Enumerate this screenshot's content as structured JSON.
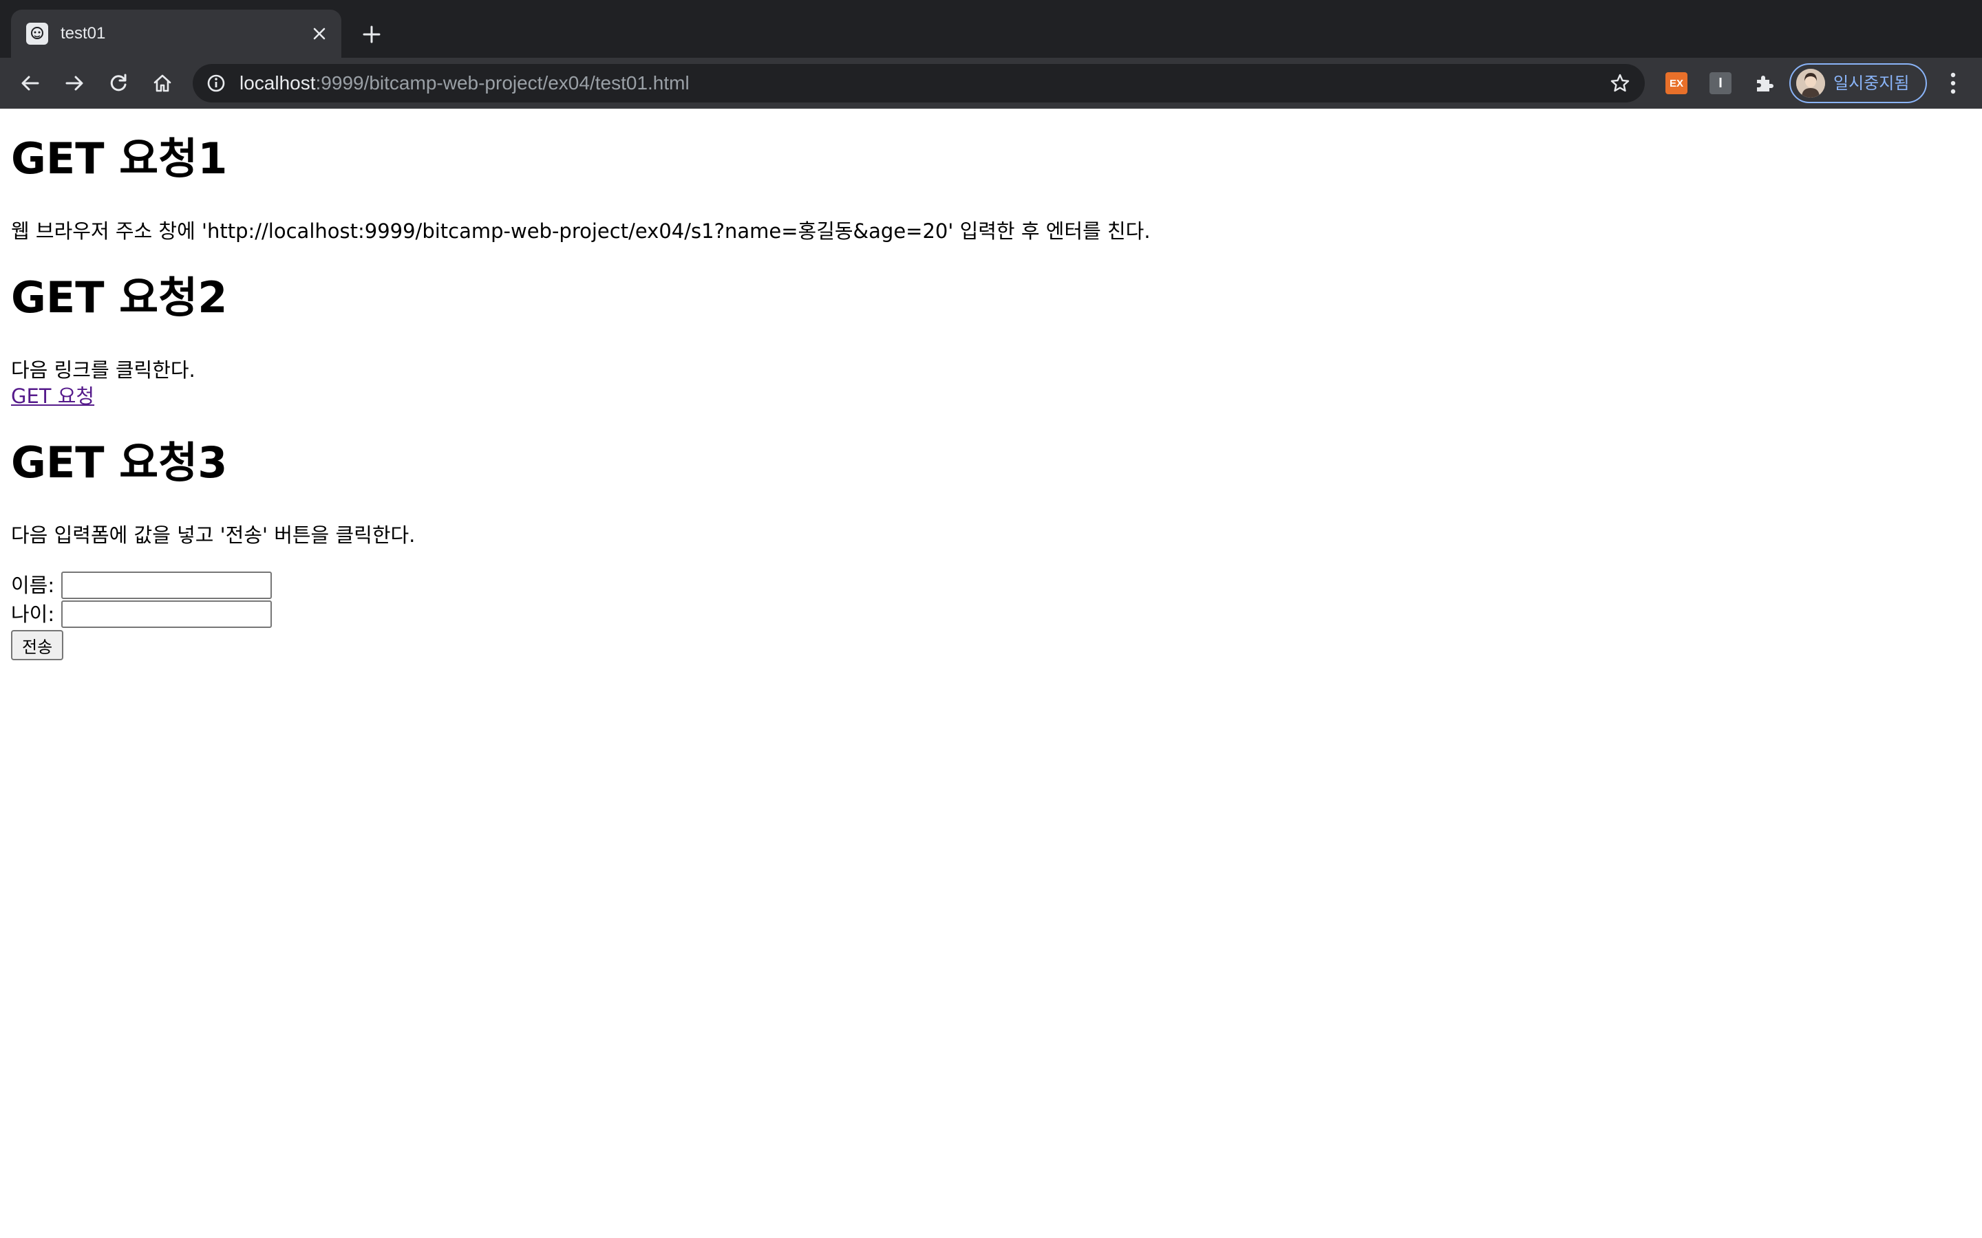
{
  "browser": {
    "tab_title": "test01",
    "url_host": "localhost",
    "url_rest": ":9999/bitcamp-web-project/ex04/test01.html",
    "profile_label": "일시중지됨",
    "extensions": [
      {
        "name": "ex-extension-icon",
        "label": "EX",
        "color": "#e8702a"
      },
      {
        "name": "i-extension-icon",
        "label": "I",
        "color": "#5f6368"
      }
    ],
    "colors": {
      "frame": "#202124",
      "toolbar": "#35363a",
      "profile_accent": "#8ab4f8"
    }
  },
  "page": {
    "section1": {
      "heading": "GET 요청1",
      "text": "웹 브라우저 주소 창에 'http://localhost:9999/bitcamp-web-project/ex04/s1?name=홍길동&age=20' 입력한 후 엔터를 친다."
    },
    "section2": {
      "heading": "GET 요청2",
      "text": "다음 링크를 클릭한다.",
      "link_label": "GET 요청"
    },
    "section3": {
      "heading": "GET 요청3",
      "text": "다음 입력폼에 값을 넣고 '전송' 버튼을 클릭한다.",
      "name_label": "이름:",
      "name_value": "",
      "age_label": "나이:",
      "age_value": "",
      "submit_label": "전송"
    },
    "link_color": "#551a8b"
  }
}
